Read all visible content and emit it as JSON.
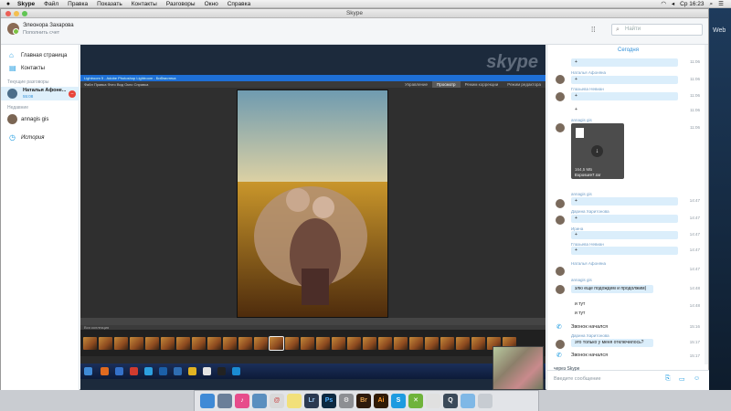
{
  "menubar": {
    "apple_icon": "apple-icon",
    "items": [
      "Skype",
      "Файл",
      "Правка",
      "Показать",
      "Контакты",
      "Разговоры",
      "Окно",
      "Справка"
    ],
    "clock": "Ср 16:23"
  },
  "window": {
    "title": "Skype"
  },
  "profile": {
    "name": "Элеонора Захарова",
    "subtitle": "Пополнить счет"
  },
  "search": {
    "placeholder": "Найти"
  },
  "sidebar": {
    "home_label": "Главная страница",
    "contacts_label": "Контакты",
    "current_head": "Текущие разговоры",
    "current_name": "Наталья Афоне...",
    "current_time": "55:08",
    "recent_head": "Недавние",
    "recent_name": "annagis gis",
    "history_label": "История"
  },
  "lightroom": {
    "titlebar": "Lightroom 5 - Adobe Photoshop Lightroom - Библиотека",
    "menu": "Файл  Правка  Фото  Вид  Окно  Справка",
    "modules": [
      "Управление",
      "Просмотр",
      "Режим коррекции",
      "Режим редактора"
    ],
    "active_module": "Просмотр",
    "filmstrip_label": "Вся коллекция"
  },
  "chat": {
    "day": "Сегодня",
    "file": {
      "size": "164,5 МБ",
      "name": "Exposure7.rar"
    },
    "senders": [
      "Наталья Афоняна",
      "Глазьева Невиан",
      "annagis gis",
      "annagis gis",
      "Дарина Харитонова",
      "Ирина",
      "Глазьева Невиан",
      "Наталья Афоняна",
      "annagis gis",
      "Дарина Харитонова"
    ],
    "messages": [
      "+",
      "+",
      "+",
      "+",
      "+",
      "+",
      "+",
      "+",
      "злю еще подождем и продолжим)",
      "и тут",
      "это только у меня отключилось?"
    ],
    "times": [
      "11:06",
      "11:06",
      "11:06",
      "11:06",
      "11:06",
      "14:47",
      "14:47",
      "14:47",
      "14:47",
      "14:47",
      "14:48",
      "14:48",
      "15:16",
      "15:17",
      "15:17"
    ],
    "call_started_1": "Звонок начался",
    "call_started_2": "Звонок начался",
    "via": "через Skype",
    "compose_placeholder": "Введите сообщение"
  },
  "dock": {
    "apps": [
      "Finder",
      "Launchpad",
      "iTunes",
      "Preview",
      "Mail",
      "Notes",
      "Lr",
      "Ps",
      "Settings",
      "Br",
      "Ai",
      "Skype",
      "X",
      "Chrome",
      "Q",
      "Folder",
      "Trash"
    ]
  },
  "desktop": {
    "label": "Web"
  }
}
